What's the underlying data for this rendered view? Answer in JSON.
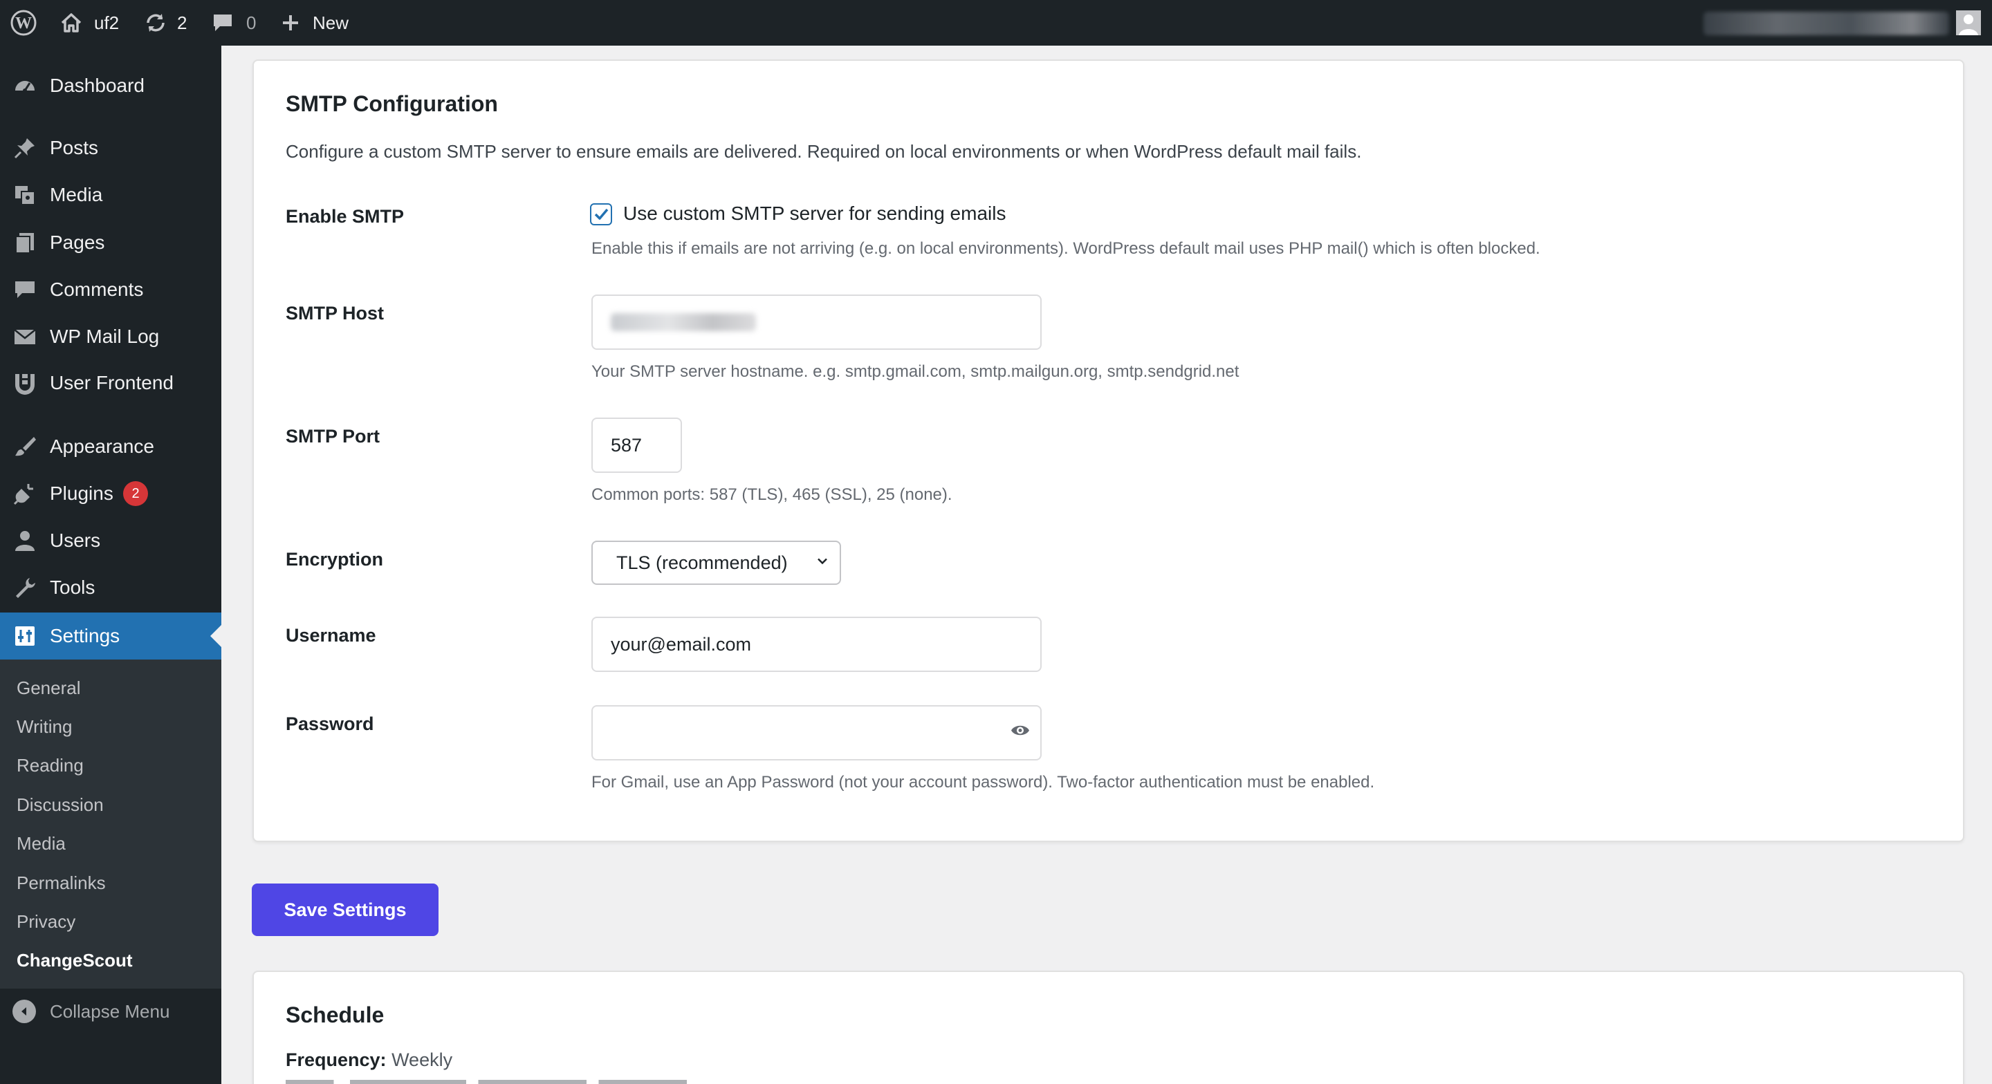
{
  "adminbar": {
    "site_name": "uf2",
    "updates_count": "2",
    "comments_count": "0",
    "new_label": "New"
  },
  "sidebar": {
    "items": [
      {
        "label": "Dashboard",
        "icon": "dashboard-icon"
      },
      {
        "label": "Posts",
        "icon": "pin-icon"
      },
      {
        "label": "Media",
        "icon": "media-icon"
      },
      {
        "label": "Pages",
        "icon": "pages-icon"
      },
      {
        "label": "Comments",
        "icon": "comment-icon"
      },
      {
        "label": "WP Mail Log",
        "icon": "mail-icon"
      },
      {
        "label": "User Frontend",
        "icon": "user-frontend-icon"
      },
      {
        "label": "Appearance",
        "icon": "brush-icon"
      },
      {
        "label": "Plugins",
        "icon": "plugin-icon",
        "badge": "2"
      },
      {
        "label": "Users",
        "icon": "user-icon"
      },
      {
        "label": "Tools",
        "icon": "wrench-icon"
      },
      {
        "label": "Settings",
        "icon": "settings-icon",
        "active": true
      }
    ],
    "submenu": [
      "General",
      "Writing",
      "Reading",
      "Discussion",
      "Media",
      "Permalinks",
      "Privacy",
      "ChangeScout"
    ],
    "submenu_current": "ChangeScout",
    "collapse_label": "Collapse Menu"
  },
  "smtp": {
    "title": "SMTP Configuration",
    "description": "Configure a custom SMTP server to ensure emails are delivered. Required on local environments or when WordPress default mail fails.",
    "enable": {
      "label": "Enable SMTP",
      "checkbox_label": "Use custom SMTP server for sending emails",
      "checked": true,
      "help": "Enable this if emails are not arriving (e.g. on local environments). WordPress default mail uses PHP mail() which is often blocked."
    },
    "host": {
      "label": "SMTP Host",
      "help": "Your SMTP server hostname. e.g. smtp.gmail.com, smtp.mailgun.org, smtp.sendgrid.net"
    },
    "port": {
      "label": "SMTP Port",
      "value": "587",
      "help": "Common ports: 587 (TLS), 465 (SSL), 25 (none)."
    },
    "encryption": {
      "label": "Encryption",
      "selected": "TLS (recommended)"
    },
    "username": {
      "label": "Username",
      "placeholder": "your@email.com"
    },
    "password": {
      "label": "Password",
      "help": "For Gmail, use an App Password (not your account password). Two-factor authentication must be enabled."
    }
  },
  "save_label": "Save Settings",
  "schedule": {
    "title": "Schedule",
    "frequency_label": "Frequency:",
    "frequency_value": "Weekly"
  },
  "colors": {
    "admin_dark": "#1d2327",
    "accent_blue": "#2271b1",
    "save_button": "#4f46e5",
    "badge_red": "#d63638"
  }
}
